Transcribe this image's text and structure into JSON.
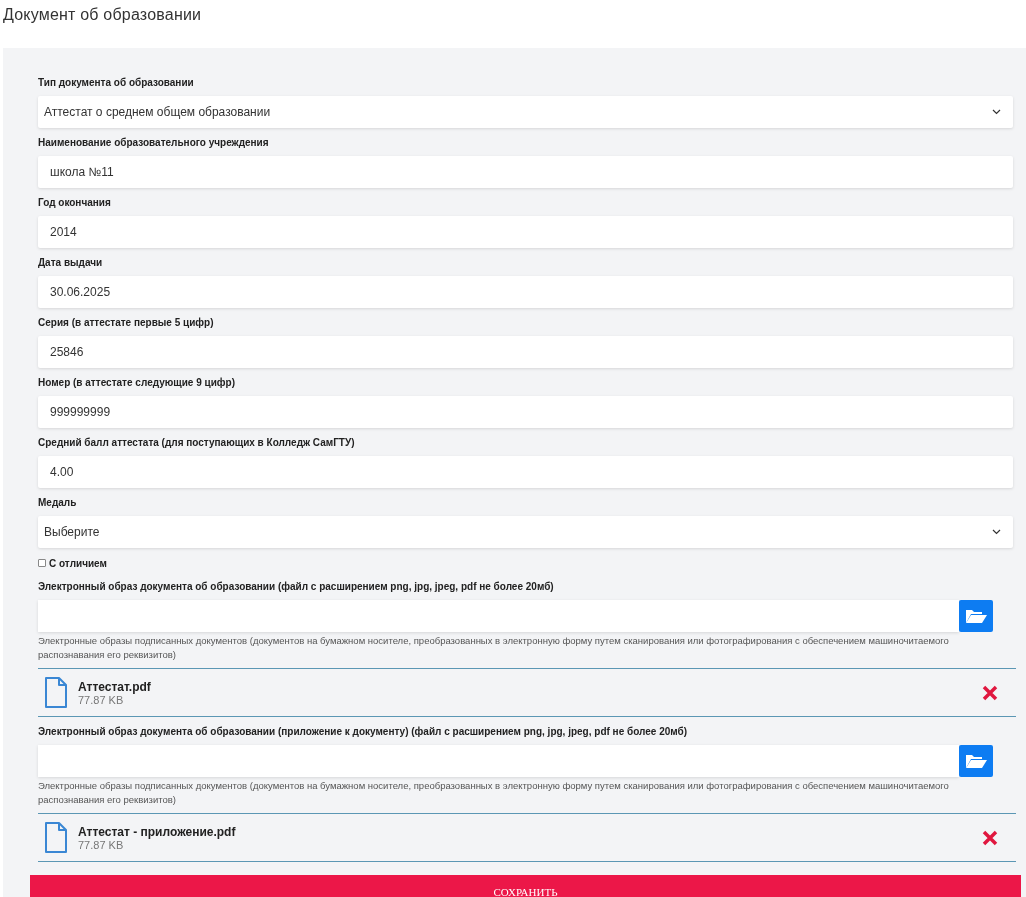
{
  "title": "Документ об образовании",
  "fields": [
    {
      "kind": "select",
      "label": "Тип документа об образовании",
      "value": "Аттестат о среднем общем образовании"
    },
    {
      "kind": "text",
      "label": "Наименование образовательного учреждения",
      "value": "школа №11"
    },
    {
      "kind": "text",
      "label": "Год окончания",
      "value": "2014"
    },
    {
      "kind": "text",
      "label": "Дата выдачи",
      "value": "30.06.2025"
    },
    {
      "kind": "text",
      "label": "Серия (в аттестате первые 5 цифр)",
      "value": "25846"
    },
    {
      "kind": "text",
      "label": "Номер (в аттестате следующие 9 цифр)",
      "value": "999999999"
    },
    {
      "kind": "text",
      "label": "Средний балл аттестата (для поступающих в Колледж СамГТУ)",
      "value": "4.00"
    },
    {
      "kind": "select",
      "label": "Медаль",
      "value": "Выберите"
    }
  ],
  "honors": {
    "label": "С отличием",
    "checked": false
  },
  "uploads": [
    {
      "label": "Электронный образ документа об образовании (файл с расширением png, jpg, jpeg, pdf не более 20мб)",
      "hint": "Электронные образы подписанных документов (документов на бумажном носителе, преобразованных в электронную форму путем сканирования или фотографирования с обеспечением машиночитаемого распознавания его реквизитов)",
      "files": [
        {
          "name": "Аттестат.pdf",
          "size": "77.87 KB"
        }
      ]
    },
    {
      "label": "Электронный образ документа об образовании (приложение к документу) (файл с расширением png, jpg, jpeg, pdf не более 20мб)",
      "hint": "Электронные образы подписанных документов (документов на бумажном носителе, преобразованных в электронную форму путем сканирования или фотографирования с обеспечением машиночитаемого распознавания его реквизитов)",
      "files": [
        {
          "name": "Аттестат - приложение.pdf",
          "size": "77.87 KB"
        }
      ]
    }
  ],
  "save_button": "СОХРАНИТЬ"
}
